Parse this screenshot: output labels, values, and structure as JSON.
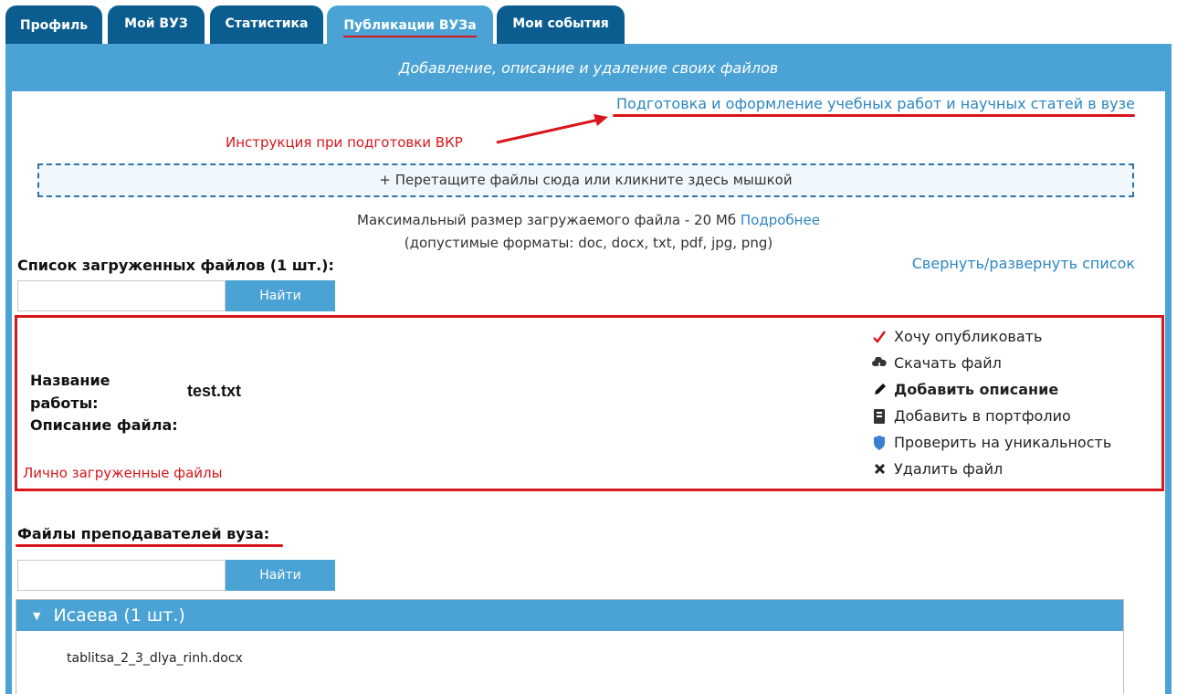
{
  "tabs": [
    {
      "label": "Профиль"
    },
    {
      "label": "Мой ВУЗ"
    },
    {
      "label": "Статистика"
    },
    {
      "label": "Публикации ВУЗа",
      "active": true
    },
    {
      "label": "Мои события"
    }
  ],
  "header": {
    "title": "Добавление, описание и удаление своих файлов"
  },
  "guide_link": "Подготовка и оформление учебных работ и научных статей в вузе",
  "annotation_instruction": "Инструкция при подготовки ВКР",
  "dropzone": {
    "label": "+ Перетащите файлы сюда или кликните здесь мышкой"
  },
  "upload_info": {
    "max_size": "Максимальный размер загружаемого файла - 20 Мб",
    "more_link": "Подробнее",
    "formats": "(допустимые форматы: doc, docx, txt, pdf, jpg, png)"
  },
  "uploaded": {
    "title": "Список загруженных файлов (1 шт.):",
    "toggle_link": "Свернуть/развернуть список",
    "search_button": "Найти",
    "search_value": "",
    "file": {
      "name_label_1": "Название",
      "name_label_2": "работы:",
      "name_value": "test.txt",
      "desc_label": "Описание файла:"
    },
    "annotation": "Лично загруженные файлы",
    "actions": [
      {
        "label": "Хочу опубликовать",
        "icon": "checkmark-icon"
      },
      {
        "label": "Скачать файл",
        "icon": "cloud-download-icon"
      },
      {
        "label": "Добавить описание",
        "icon": "pencil-icon"
      },
      {
        "label": "Добавить в портфолио",
        "icon": "portfolio-icon"
      },
      {
        "label": "Проверить на уникальность",
        "icon": "shield-icon"
      },
      {
        "label": "Удалить файл",
        "icon": "close-icon"
      }
    ]
  },
  "teachers": {
    "title": "Файлы преподавателей вуза:",
    "search_button": "Найти",
    "search_value": "",
    "groups": [
      {
        "name": "Исаева (1 шт.)",
        "files": [
          "tablitsa_2_3_dlya_rinh.docx"
        ]
      }
    ]
  },
  "colors": {
    "tab_dark": "#0b5d8f",
    "accent": "#4aa3d4",
    "annotation_red": "#d9161b",
    "link": "#2d86c1"
  }
}
